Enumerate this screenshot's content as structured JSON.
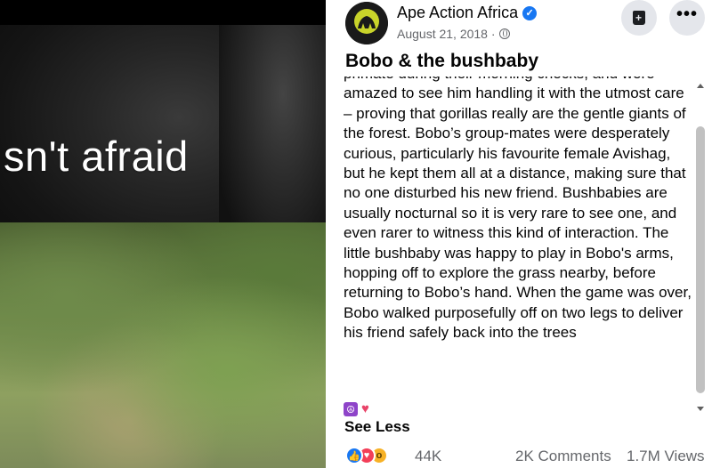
{
  "video": {
    "caption": "sn't afraid"
  },
  "post": {
    "page_name": "Ape Action Africa",
    "date": "August 21, 2018 ·",
    "title": "Bobo & the bushbaby",
    "body": "primate during their morning checks, and were amazed to see him handling it with the utmost care – proving that gorillas really are the gentle giants of the forest. Bobo’s group-mates were desperately curious, particularly his favourite female Avishag, but he kept them all at a distance, making sure that no one disturbed his new friend. Bushbabies are usually nocturnal so it is very rare to see one, and even rarer to witness this kind of interaction. The little bushbaby was happy to play in Bobo's arms, hopping off to explore the grass nearby, before returning to Bobo’s hand. When the game was over, Bobo walked purposefully off on two legs to deliver his friend safely back into the trees",
    "see_less": "See Less"
  },
  "icons": {
    "verified": "verified-badge-icon",
    "globe": "globe-icon",
    "save": "save-icon",
    "more": "more-icon"
  },
  "stats": {
    "reactions": "44K",
    "comments": "2K Comments",
    "views": "1.7M Views"
  },
  "colors": {
    "accent": "#1877f2",
    "muted_text": "#65676b",
    "button_bg": "#e4e6eb"
  }
}
